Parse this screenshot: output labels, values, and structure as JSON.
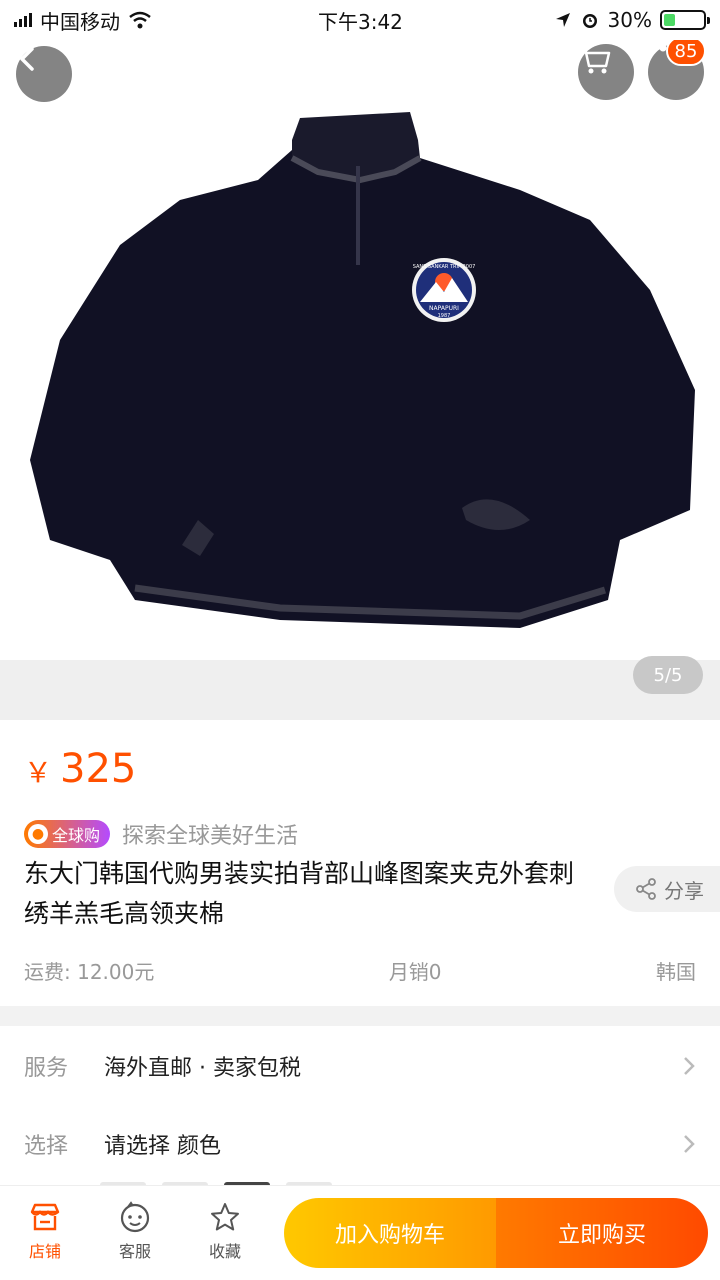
{
  "status_bar": {
    "carrier": "中国移动",
    "time": "下午3:42",
    "battery_text": "30%",
    "battery_level": 0.3
  },
  "header": {
    "cart_badge": "85"
  },
  "gallery": {
    "pager": "5/5",
    "patch_top_text": "SANS SANKAR TRIP 2007",
    "patch_mid_text": "NAPAPURI",
    "patch_year": "1987"
  },
  "product": {
    "currency_symbol": "￥",
    "price": "325",
    "global_tag": "全球购",
    "slogan": "探索全球美好生活",
    "title": "东大门韩国代购男装实拍背部山峰图案夹克外套刺绣羊羔毛高领夹棉",
    "share_label": "分享",
    "shipping": "运费: 12.00元",
    "monthly_sales": "月销0",
    "origin": "韩国"
  },
  "options": {
    "service_label": "服务",
    "service_value": "海外直邮 · 卖家包税",
    "select_label": "选择",
    "select_value": "请选择 颜色"
  },
  "bottom_bar": {
    "store_label": "店铺",
    "service_label": "客服",
    "favorite_label": "收藏",
    "add_to_cart_label": "加入购物车",
    "buy_now_label": "立即购买"
  },
  "colors": {
    "accent": "#ff5000",
    "cart_button_start": "#ffc800",
    "buy_button_end": "#ff4a00",
    "battery_green": "#4cd964"
  },
  "icons": [
    "signal-icon",
    "wifi-icon",
    "location-icon",
    "alarm-icon",
    "battery-icon",
    "back-arrow-icon",
    "cart-icon",
    "more-icon",
    "share-icon",
    "chevron-right-icon",
    "store-icon",
    "service-face-icon",
    "star-icon"
  ]
}
